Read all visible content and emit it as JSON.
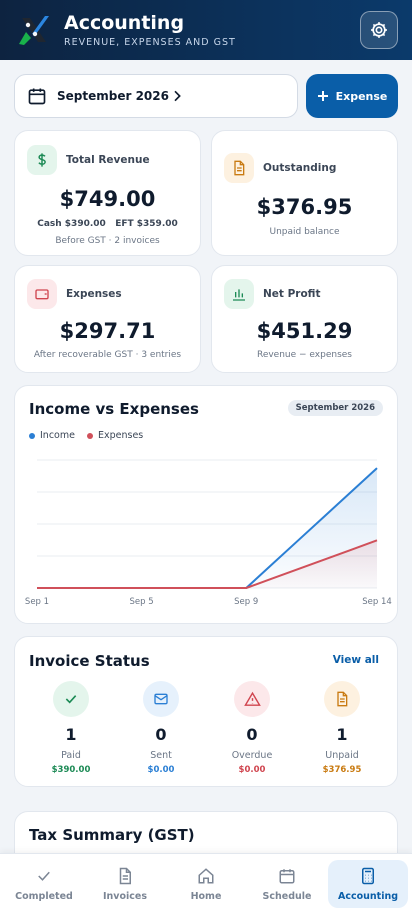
{
  "header": {
    "title": "Accounting",
    "subtitle": "REVENUE, EXPENSES AND GST"
  },
  "month_selector": {
    "label": "September 2026"
  },
  "add_expense_label": "Expense",
  "stats": {
    "revenue": {
      "label": "Total Revenue",
      "value": "$749.00",
      "cash": "Cash $390.00",
      "eft": "EFT $359.00",
      "sub": "Before GST · 2 invoices"
    },
    "outstanding": {
      "label": "Outstanding",
      "value": "$376.95",
      "sub": "Unpaid balance"
    },
    "expenses": {
      "label": "Expenses",
      "value": "$297.71",
      "sub": "After recoverable GST · 3 entries"
    },
    "profit": {
      "label": "Net Profit",
      "value": "$451.29",
      "sub": "Revenue − expenses"
    }
  },
  "chart_card": {
    "title": "Income vs Expenses",
    "period": "September 2026",
    "legend_income": "Income",
    "legend_expenses": "Expenses",
    "x_ticks": [
      "Sep 1",
      "Sep 5",
      "Sep 9",
      "Sep 14"
    ]
  },
  "chart_data": {
    "type": "line",
    "x": [
      "Sep 1",
      "Sep 2",
      "Sep 3",
      "Sep 4",
      "Sep 5",
      "Sep 6",
      "Sep 7",
      "Sep 8",
      "Sep 9",
      "Sep 10",
      "Sep 11",
      "Sep 12",
      "Sep 13",
      "Sep 14"
    ],
    "series": [
      {
        "name": "Income",
        "color": "#2b7fd4",
        "values": [
          0,
          0,
          0,
          0,
          0,
          0,
          0,
          0,
          0,
          149.8,
          299.6,
          449.4,
          599.2,
          749.0
        ]
      },
      {
        "name": "Expenses",
        "color": "#d0505a",
        "values": [
          0,
          0,
          0,
          0,
          0,
          0,
          0,
          0,
          0,
          59.5,
          119.1,
          178.6,
          238.2,
          297.7
        ]
      }
    ],
    "ylim": [
      0,
      800
    ],
    "grid": true,
    "legend": "top-left"
  },
  "invoice_status": {
    "title": "Invoice Status",
    "view_all": "View all",
    "items": [
      {
        "label": "Paid",
        "count": "1",
        "amount": "$390.00",
        "color": "#1c8a55",
        "bg": "#e4f5ec",
        "icon": "check-icon"
      },
      {
        "label": "Sent",
        "count": "0",
        "amount": "$0.00",
        "color": "#2b7fd4",
        "bg": "#e6f1fc",
        "icon": "mail-icon"
      },
      {
        "label": "Overdue",
        "count": "0",
        "amount": "$0.00",
        "color": "#d0454f",
        "bg": "#fce8ea",
        "icon": "warning-icon"
      },
      {
        "label": "Unpaid",
        "count": "1",
        "amount": "$376.95",
        "color": "#c97b12",
        "bg": "#fdf1e0",
        "icon": "document-icon"
      }
    ]
  },
  "tax_summary": {
    "title": "Tax Summary (GST)"
  },
  "nav": {
    "items": [
      {
        "label": "Completed",
        "icon": "check-icon"
      },
      {
        "label": "Invoices",
        "icon": "document-icon"
      },
      {
        "label": "Home",
        "icon": "home-icon"
      },
      {
        "label": "Schedule",
        "icon": "calendar-icon"
      },
      {
        "label": "Accounting",
        "icon": "calculator-icon",
        "active": true
      }
    ]
  }
}
